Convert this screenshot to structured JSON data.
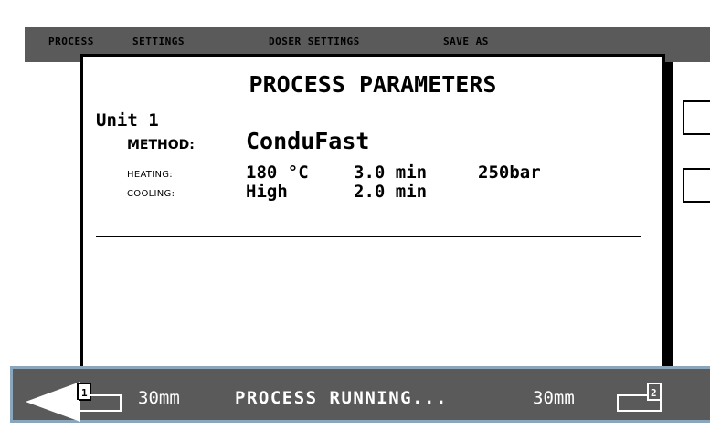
{
  "menu": {
    "items": [
      "PROCESS",
      "SETTINGS",
      "DOSER SETTINGS",
      "SAVE AS"
    ]
  },
  "dialog": {
    "title": "PROCESS PARAMETERS",
    "unit": "Unit 1",
    "method_label": "METHOD:",
    "method_value": "ConduFast",
    "heating_label": "HEATING:",
    "heating_temp": "180 °C",
    "heating_time": "3.0 min",
    "heating_pressure": "250bar",
    "cooling_label": "COOLING:",
    "cooling_level": "High",
    "cooling_time": "2.0 min"
  },
  "status": {
    "left_number": "1",
    "left_size": "30mm",
    "message": "PROCESS RUNNING...",
    "right_size": "30mm",
    "right_number": "2"
  },
  "colors": {
    "bar": "#5a5a5a",
    "status_border": "#8aa6bd",
    "text_light": "#ffffff"
  }
}
